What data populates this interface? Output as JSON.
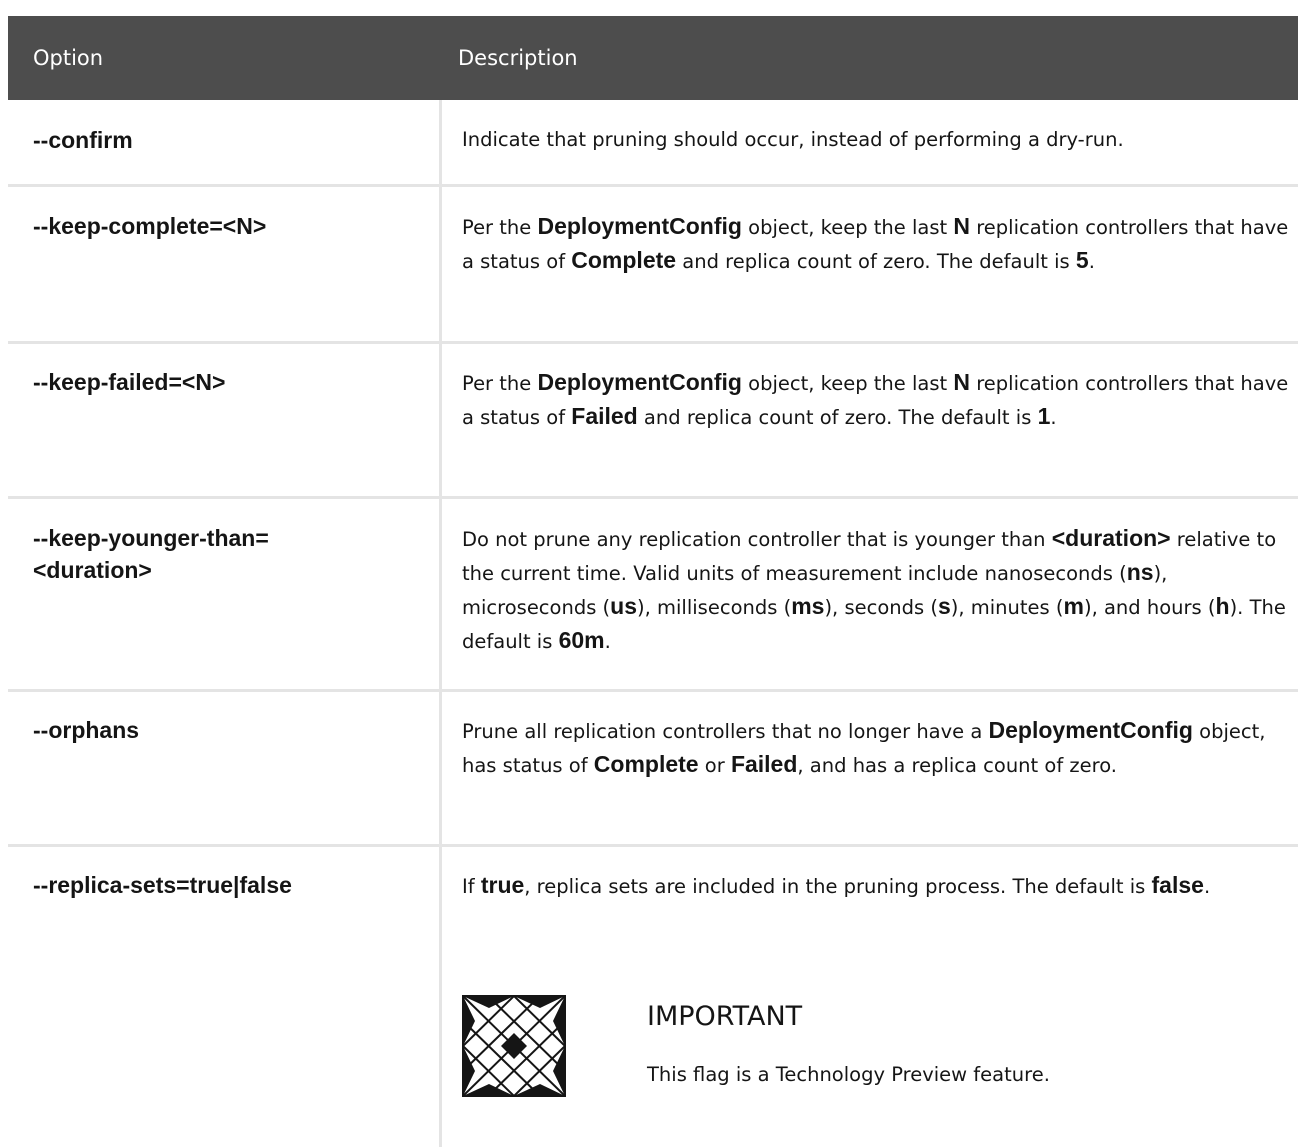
{
  "table": {
    "headers": {
      "option": "Option",
      "description": "Description"
    },
    "rows": [
      {
        "option": "--confirm",
        "desc": [
          {
            "t": "Indicate that pruning should occur, instead of performing a dry-run."
          }
        ]
      },
      {
        "option": "--keep-complete=<N>",
        "desc": [
          {
            "t": "Per the "
          },
          {
            "t": "DeploymentConfig",
            "b": true
          },
          {
            "t": " object, keep the last "
          },
          {
            "t": "N",
            "b": true
          },
          {
            "t": " replication controllers that have a status of "
          },
          {
            "t": "Complete",
            "b": true
          },
          {
            "t": " and replica count of zero. The default is "
          },
          {
            "t": "5",
            "b": true
          },
          {
            "t": "."
          }
        ]
      },
      {
        "option": "--keep-failed=<N>",
        "desc": [
          {
            "t": "Per the "
          },
          {
            "t": "DeploymentConfig",
            "b": true
          },
          {
            "t": " object, keep the last "
          },
          {
            "t": "N",
            "b": true
          },
          {
            "t": " replication controllers that have a status of "
          },
          {
            "t": "Failed",
            "b": true
          },
          {
            "t": " and replica count of zero. The default is "
          },
          {
            "t": "1",
            "b": true
          },
          {
            "t": "."
          }
        ]
      },
      {
        "option": "--keep-younger-than=<duration>",
        "desc": [
          {
            "t": "Do not prune any replication controller that is younger than "
          },
          {
            "t": "<duration>",
            "b": true
          },
          {
            "t": " relative to the current time. Valid units of measurement include nanoseconds ("
          },
          {
            "t": "ns",
            "b": true
          },
          {
            "t": "), microseconds ("
          },
          {
            "t": "us",
            "b": true
          },
          {
            "t": "), milliseconds ("
          },
          {
            "t": "ms",
            "b": true
          },
          {
            "t": "), seconds ("
          },
          {
            "t": "s",
            "b": true
          },
          {
            "t": "), minutes ("
          },
          {
            "t": "m",
            "b": true
          },
          {
            "t": "), and hours ("
          },
          {
            "t": "h",
            "b": true
          },
          {
            "t": "). The default is "
          },
          {
            "t": "60m",
            "b": true
          },
          {
            "t": "."
          }
        ]
      },
      {
        "option": "--orphans",
        "desc": [
          {
            "t": "Prune all replication controllers that no longer have a "
          },
          {
            "t": "DeploymentConfig",
            "b": true
          },
          {
            "t": " object, has status of "
          },
          {
            "t": "Complete",
            "b": true
          },
          {
            "t": " or "
          },
          {
            "t": "Failed",
            "b": true
          },
          {
            "t": ", and has a replica count of zero."
          }
        ]
      },
      {
        "option": "--replica-sets=true|false",
        "desc": [
          {
            "t": "If "
          },
          {
            "t": "true",
            "b": true
          },
          {
            "t": ", replica sets are included in the pruning process. The default is "
          },
          {
            "t": "false",
            "b": true
          },
          {
            "t": "."
          }
        ]
      }
    ],
    "admonition": {
      "icon": "important-icon",
      "title": "IMPORTANT",
      "text": "This flag is a Technology Preview feature."
    }
  }
}
